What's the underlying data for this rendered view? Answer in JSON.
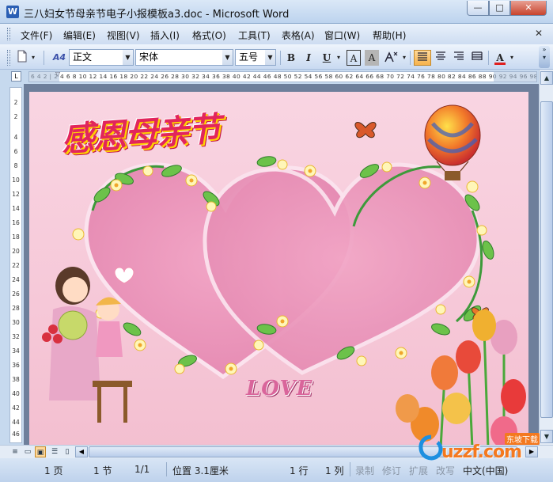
{
  "window": {
    "title": "三八妇女节母亲节电子小报模板a3.doc - Microsoft Word",
    "app_icon": "W",
    "minimize": "—",
    "maximize": "□",
    "close": "✕"
  },
  "menu": {
    "items": [
      "文件(F)",
      "编辑(E)",
      "视图(V)",
      "插入(I)",
      "格式(O)",
      "工具(T)",
      "表格(A)",
      "窗口(W)",
      "帮助(H)"
    ],
    "close_doc": "✕"
  },
  "toolbar": {
    "style_value": "正文",
    "font_value": "宋体",
    "size_value": "五号",
    "bold": "B",
    "italic": "I",
    "underline": "U",
    "char_border": "A",
    "char_shading": "A",
    "font_color": "A",
    "style_icon_label": "A4",
    "colors": {
      "font_color_bar": "#e0201f",
      "active_button": "#f6b24d"
    }
  },
  "ruler": {
    "horizontal_scale": "6 4 2 | 2 4 6 8 10 12 14 16 18 20 22 24 26 28 30 32 34 36 38 40 42 44 46 48 50 52 54 56 58 60 62 64 66 68 70 72 74 76 78 80 82 84 86 88 90 92 94 96 98 | 102 104 106",
    "vertical_ticks": [
      "2",
      "2",
      "4",
      "6",
      "8",
      "10",
      "12",
      "14",
      "16",
      "18",
      "20",
      "22",
      "24",
      "26",
      "28",
      "30",
      "32",
      "34",
      "36",
      "38",
      "40",
      "42",
      "44",
      "46",
      "48"
    ]
  },
  "page": {
    "headline": "感恩母亲节",
    "love_text": "LOVE",
    "watermark_brand": "uzzf.com",
    "watermark_cn": "东坡下载"
  },
  "statusbar": {
    "page": "1 页",
    "section": "1 节",
    "page_count": "1/1",
    "position": "位置 3.1厘米",
    "line": "1 行",
    "column": "1 列",
    "record": "录制",
    "revise": "修订",
    "extend": "扩展",
    "overwrite": "改写",
    "language": "中文(中国)"
  }
}
